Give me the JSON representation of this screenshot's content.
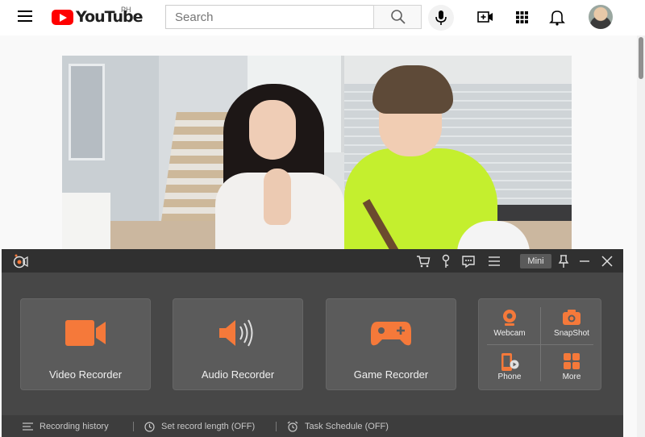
{
  "youtube": {
    "logo_text": "YouTube",
    "country_code": "PH",
    "search": {
      "placeholder": "Search",
      "value": ""
    }
  },
  "recorder": {
    "mini_label": "Mini",
    "tiles": [
      {
        "label": "Video Recorder"
      },
      {
        "label": "Audio Recorder"
      },
      {
        "label": "Game Recorder"
      }
    ],
    "tools": [
      {
        "label": "Webcam"
      },
      {
        "label": "SnapShot"
      },
      {
        "label": "Phone"
      },
      {
        "label": "More"
      }
    ],
    "footer": {
      "history": "Recording history",
      "record_length": "Set record length (OFF)",
      "task_schedule": "Task Schedule (OFF)"
    },
    "colors": {
      "accent": "#f5793a",
      "panel": "#474747",
      "tile": "#5b5b5b"
    }
  }
}
